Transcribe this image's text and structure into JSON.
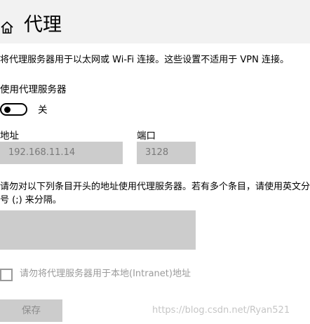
{
  "header": {
    "title": "代理",
    "home_icon": "home-icon"
  },
  "description": "将代理服务器用于以太网或 Wi-Fi 连接。这些设置不适用于 VPN 连接。",
  "use_proxy": {
    "label": "使用代理服务器",
    "state": "关",
    "enabled": false
  },
  "address": {
    "label": "地址",
    "value": "192.168.11.14"
  },
  "port": {
    "label": "端口",
    "value": "3128"
  },
  "exceptions": {
    "description": "请勿对以下列条目开头的地址使用代理服务器。若有多个条目，请使用英文分号 (;) 来分隔。",
    "value": ""
  },
  "local_bypass": {
    "label": "请勿将代理服务器用于本地(Intranet)地址",
    "checked": false
  },
  "save_button": "保存",
  "watermark": "https://blog.csdn.net/Ryan521"
}
